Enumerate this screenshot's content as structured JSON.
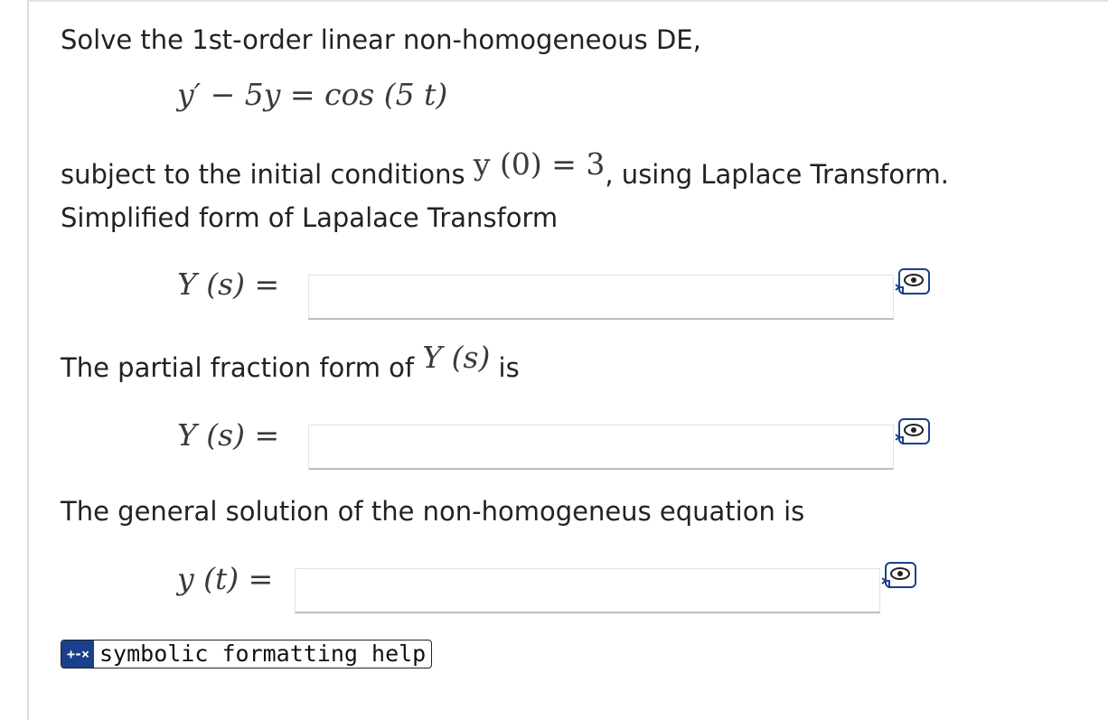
{
  "question": {
    "intro": "Solve the 1st-order linear non-homogeneous DE,",
    "equation": "y′ − 5y = cos (5 t)",
    "condition_prefix": "subject to the initial conditions",
    "condition_math": "y (0) = 3",
    "condition_suffix": ", using Laplace Transform.",
    "simplified_heading": "Simplified form of Lapalace Transform",
    "partial_prefix": "The partial fraction form of",
    "partial_math": "Y (s)",
    "partial_suffix": "is",
    "general_heading": "The general solution of the non-homogeneus equation is"
  },
  "answers": [
    {
      "label": "Y (s) =",
      "value": "",
      "preview_icon": "eye-preview-icon"
    },
    {
      "label": "Y (s) =",
      "value": "",
      "preview_icon": "eye-preview-icon"
    },
    {
      "label": "y (t) =",
      "value": "",
      "preview_icon": "eye-preview-icon"
    }
  ],
  "help": {
    "icon_text": "+-×",
    "label": "symbolic formatting help"
  },
  "colors": {
    "help_icon_bg": "#1a3f8c",
    "text": "#222222",
    "math": "#3a3a3a"
  }
}
